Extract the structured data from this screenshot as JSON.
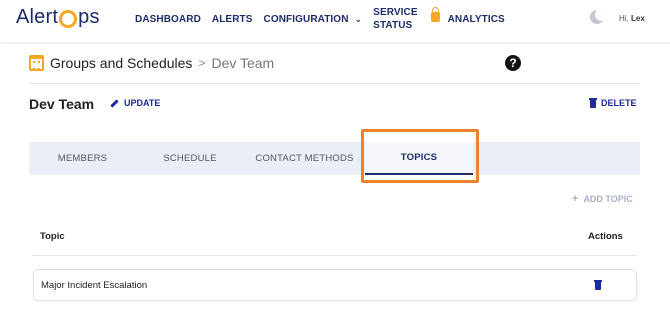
{
  "brand": {
    "logo_left": "Alert",
    "logo_right": "ps"
  },
  "nav": {
    "items": [
      "DASHBOARD",
      "ALERTS",
      "CONFIGURATION"
    ],
    "service_status_line1": "SERVICE",
    "service_status_line2": "STATUS",
    "analytics": "ANALYTICS"
  },
  "user": {
    "greeting": "Hi,",
    "name": "Lex"
  },
  "breadcrumb": {
    "main": "Groups and Schedules",
    "separator": ">",
    "current": "Dev Team"
  },
  "help_icon_text": "?",
  "group": {
    "name": "Dev Team",
    "update_label": "UPDATE",
    "delete_label": "DELETE"
  },
  "tabs": [
    "MEMBERS",
    "SCHEDULE",
    "CONTACT METHODS",
    "TOPICS"
  ],
  "active_tab": "TOPICS",
  "add_topic_label": "ADD TOPIC",
  "table": {
    "headers": {
      "topic": "Topic",
      "actions": "Actions"
    },
    "rows": [
      {
        "topic": "Major Incident Escalation"
      }
    ]
  },
  "colors": {
    "brand_navy": "#1d2b6b",
    "accent_orange": "#f5a623",
    "highlight_orange": "#f0822e",
    "tab_bg": "#eaeef7"
  },
  "icons": [
    "sun-moon-icon",
    "calendar-icon",
    "help-icon",
    "pencil-icon",
    "trash-icon",
    "lock-icon",
    "chevron-down-icon",
    "plus-icon"
  ]
}
